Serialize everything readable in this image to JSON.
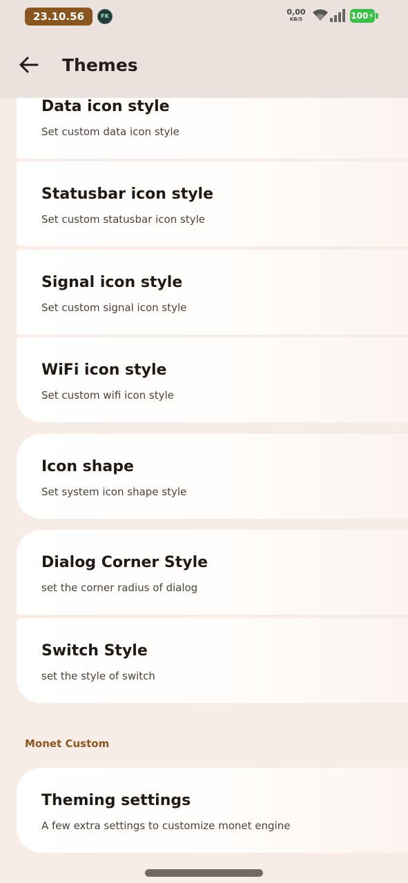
{
  "status_bar": {
    "time": "23.10.56",
    "notification_icon_label": "FK",
    "net_speed_value": "0,00",
    "net_speed_unit": "KB/S",
    "battery": "100",
    "colors": {
      "time_pill": "#8a561f",
      "battery": "#3cbf4a"
    },
    "icons": [
      "wifi-icon",
      "signal-icon",
      "battery-icon"
    ]
  },
  "app_bar": {
    "title": "Themes",
    "back_icon": "arrow-left-icon"
  },
  "settings": [
    {
      "title": "Data icon style",
      "subtitle": "Set custom data icon style"
    },
    {
      "title": "Statusbar icon style",
      "subtitle": "Set custom statusbar icon style"
    },
    {
      "title": "Signal icon style",
      "subtitle": "Set custom signal icon style"
    },
    {
      "title": "WiFi icon style",
      "subtitle": "Set custom wifi icon style"
    },
    {
      "title": "Icon shape",
      "subtitle": "Set system icon shape style"
    },
    {
      "title": "Dialog Corner Style",
      "subtitle": "set the corner radius of dialog"
    },
    {
      "title": "Switch Style",
      "subtitle": "set the style of switch"
    }
  ],
  "monet_section": {
    "header": "Monet Custom",
    "items": [
      {
        "title": "Theming settings",
        "subtitle": "A few extra settings to customize monet engine"
      }
    ]
  },
  "colors": {
    "background": "#f7ede6",
    "accent": "#8a561f",
    "card": "#ffffff"
  }
}
